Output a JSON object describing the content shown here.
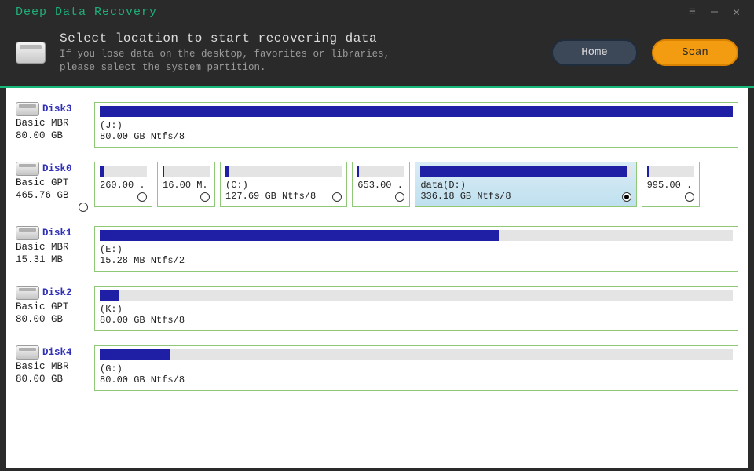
{
  "app": {
    "title": "Deep Data Recovery"
  },
  "header": {
    "title": "Select location to start recovering data",
    "subtitle": "If you lose data on the desktop, favorites or libraries,\nplease select the system partition.",
    "home_label": "Home",
    "scan_label": "Scan"
  },
  "disks": [
    {
      "name": "Disk3",
      "type": "Basic MBR",
      "size": "80.00 GB",
      "head_radio": false,
      "partitions": [
        {
          "label": "(J:)",
          "detail": "80.00 GB Ntfs/8",
          "fill": 100,
          "flex": 1,
          "radio": false,
          "selected": false
        }
      ]
    },
    {
      "name": "Disk0",
      "type": "Basic GPT",
      "size": "465.76 GB",
      "head_radio": true,
      "partitions": [
        {
          "label": "",
          "detail": "260.00 .",
          "fill": 8,
          "flex": 0.085,
          "radio": true,
          "selected": false
        },
        {
          "label": "",
          "detail": "16.00 M.",
          "fill": 4,
          "flex": 0.085,
          "radio": true,
          "selected": false
        },
        {
          "label": "(C:)",
          "detail": "127.69 GB Ntfs/8",
          "fill": 3,
          "flex": 0.21,
          "radio": true,
          "selected": false
        },
        {
          "label": "",
          "detail": "653.00 .",
          "fill": 3,
          "flex": 0.085,
          "radio": true,
          "selected": false
        },
        {
          "label": "data(D:)",
          "detail": "336.18 GB Ntfs/8",
          "fill": 98,
          "flex": 0.38,
          "radio": true,
          "selected": true
        },
        {
          "label": "",
          "detail": "995.00 .",
          "fill": 4,
          "flex": 0.085,
          "radio": true,
          "selected": false
        }
      ]
    },
    {
      "name": "Disk1",
      "type": "Basic MBR",
      "size": "15.31 MB",
      "head_radio": false,
      "partitions": [
        {
          "label": "(E:)",
          "detail": "15.28 MB Ntfs/2",
          "fill": 63,
          "flex": 1,
          "radio": false,
          "selected": false
        }
      ]
    },
    {
      "name": "Disk2",
      "type": "Basic GPT",
      "size": "80.00 GB",
      "head_radio": false,
      "partitions": [
        {
          "label": "(K:)",
          "detail": "80.00 GB Ntfs/8",
          "fill": 3,
          "flex": 1,
          "radio": false,
          "selected": false
        }
      ]
    },
    {
      "name": "Disk4",
      "type": "Basic MBR",
      "size": "80.00 GB",
      "head_radio": false,
      "partitions": [
        {
          "label": "(G:)",
          "detail": "80.00 GB Ntfs/8",
          "fill": 11,
          "flex": 1,
          "radio": false,
          "selected": false
        }
      ]
    }
  ]
}
